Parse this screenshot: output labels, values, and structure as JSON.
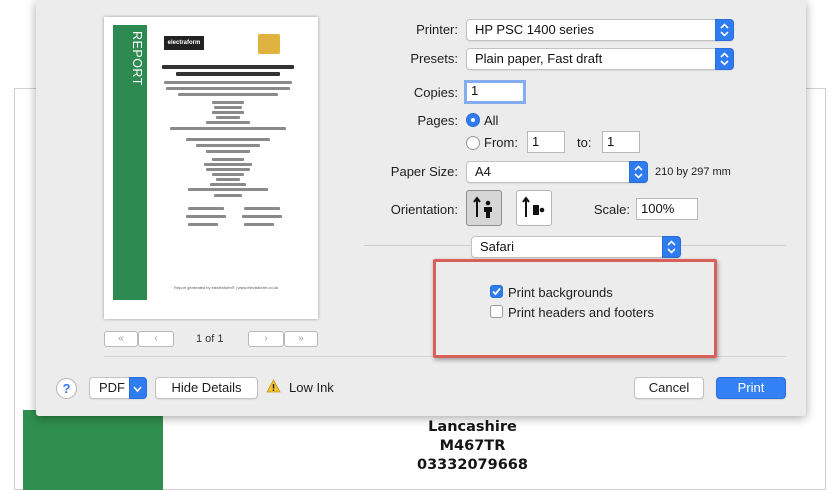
{
  "background_doc": {
    "lines": [
      "Lancashire",
      "M467TR",
      "03332079668"
    ]
  },
  "preview": {
    "strip_text": "REPORT",
    "logo_text": "electraform",
    "footer_text": "Report generated by electraform® | www.electraform.co.uk",
    "page_indicator": "1 of 1",
    "first_label": "«",
    "prev_label": "‹",
    "next_label": "›",
    "last_label": "»"
  },
  "printer": {
    "label": "Printer:",
    "value": "HP PSC 1400 series"
  },
  "presets": {
    "label": "Presets:",
    "value": "Plain paper, Fast draft"
  },
  "copies": {
    "label": "Copies:",
    "value": "1"
  },
  "pages": {
    "label": "Pages:",
    "all_label": "All",
    "from_label": "From:",
    "from_value": "1",
    "to_label": "to:",
    "to_value": "1",
    "selected": "All"
  },
  "paper_size": {
    "label": "Paper Size:",
    "value": "A4",
    "dimensions": "210 by 297 mm"
  },
  "orientation": {
    "label": "Orientation:",
    "selected": "portrait"
  },
  "scale": {
    "label": "Scale:",
    "value": "100%"
  },
  "app_section": {
    "value": "Safari"
  },
  "options": {
    "print_backgrounds": {
      "label": "Print backgrounds",
      "checked": true
    },
    "headers_footers": {
      "label": "Print headers and footers",
      "checked": false
    }
  },
  "footer": {
    "help_label": "?",
    "pdf_label": "PDF",
    "hide_details_label": "Hide Details",
    "low_ink_label": "Low Ink",
    "cancel_label": "Cancel",
    "print_label": "Print"
  },
  "colors": {
    "accent": "#2f7bf0",
    "report_green": "#2d8a50",
    "highlight": "#d9605a"
  }
}
